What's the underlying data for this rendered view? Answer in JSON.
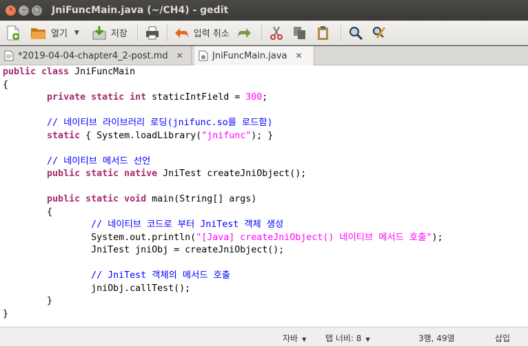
{
  "window": {
    "title": "JniFuncMain.java (~/CH4) - gedit",
    "close_glyph": "✕",
    "min_glyph": "–",
    "max_glyph": "▢"
  },
  "toolbar": {
    "open_label": "열기",
    "save_label": "저장",
    "undo_label": "입력 취소"
  },
  "tabs": [
    {
      "label": "*2019-04-04-chapter4_2-post.md",
      "close": "✕"
    },
    {
      "label": "JniFuncMain.java",
      "close": "✕"
    }
  ],
  "code": [
    [
      {
        "t": "public class",
        "c": "kw"
      },
      {
        "t": " JniFuncMain",
        "c": ""
      }
    ],
    [
      {
        "t": "{",
        "c": ""
      }
    ],
    [
      {
        "t": "        ",
        "c": ""
      },
      {
        "t": "private static int",
        "c": "kw"
      },
      {
        "t": " staticIntField = ",
        "c": ""
      },
      {
        "t": "300",
        "c": "num"
      },
      {
        "t": ";",
        "c": ""
      }
    ],
    [],
    [
      {
        "t": "        ",
        "c": ""
      },
      {
        "t": "// 네이티브 라이브러리 로딩(jnifunc.so를 로드함)",
        "c": "cm"
      }
    ],
    [
      {
        "t": "        ",
        "c": ""
      },
      {
        "t": "static",
        "c": "kw"
      },
      {
        "t": " { System.loadLibrary(",
        "c": ""
      },
      {
        "t": "\"jnifunc\"",
        "c": "st"
      },
      {
        "t": "); }",
        "c": ""
      }
    ],
    [],
    [
      {
        "t": "        ",
        "c": ""
      },
      {
        "t": "// 네이티브 메서드 선언",
        "c": "cm"
      }
    ],
    [
      {
        "t": "        ",
        "c": ""
      },
      {
        "t": "public static native",
        "c": "kw"
      },
      {
        "t": " JniTest createJniObject();",
        "c": ""
      }
    ],
    [],
    [
      {
        "t": "        ",
        "c": ""
      },
      {
        "t": "public static void",
        "c": "kw"
      },
      {
        "t": " main(String[] args)",
        "c": ""
      }
    ],
    [
      {
        "t": "        {",
        "c": ""
      }
    ],
    [
      {
        "t": "                ",
        "c": ""
      },
      {
        "t": "// 네이티브 코드로 부터 JniTest 객체 생성",
        "c": "cm"
      }
    ],
    [
      {
        "t": "                System.out.println(",
        "c": ""
      },
      {
        "t": "\"[Java] createJniObject() 네이티브 메서드 호출\"",
        "c": "st"
      },
      {
        "t": ");",
        "c": ""
      }
    ],
    [
      {
        "t": "                JniTest jniObj = createJniObject();",
        "c": ""
      }
    ],
    [],
    [
      {
        "t": "                ",
        "c": ""
      },
      {
        "t": "// JniTest 객체의 메서드 호출",
        "c": "cm"
      }
    ],
    [
      {
        "t": "                jniObj.callTest();",
        "c": ""
      }
    ],
    [
      {
        "t": "        }",
        "c": ""
      }
    ],
    [
      {
        "t": "}",
        "c": ""
      }
    ]
  ],
  "statusbar": {
    "language": "자바",
    "tab_width": "탭 너비: 8",
    "position": "3행, 49열",
    "mode": "삽입"
  }
}
